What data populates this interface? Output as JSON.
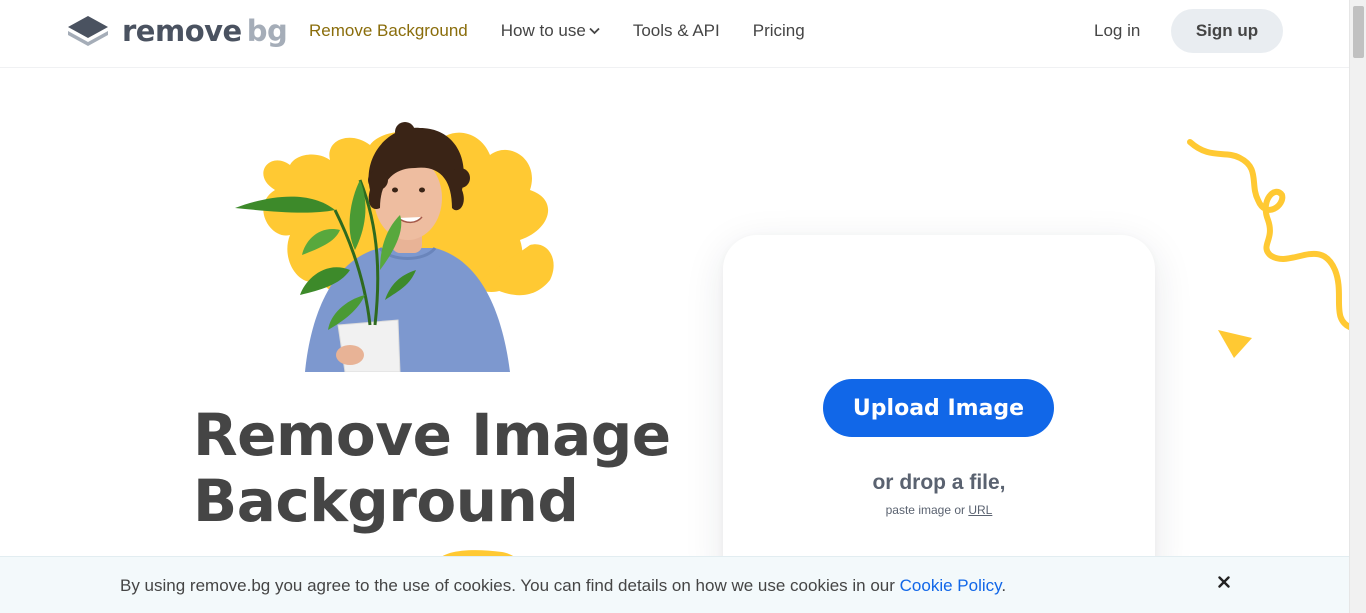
{
  "brand": {
    "word_1": "remove",
    "word_2": "bg",
    "colors": {
      "dark": "#4a5260",
      "light": "#a5adb8"
    }
  },
  "nav": {
    "items": [
      {
        "label": "Remove Background",
        "active": true
      },
      {
        "label": "How to use",
        "has_dropdown": true
      },
      {
        "label": "Tools & API"
      },
      {
        "label": "Pricing"
      }
    ],
    "login_label": "Log in",
    "signup_label": "Sign up"
  },
  "hero": {
    "title_line_1": "Remove Image",
    "title_line_2": "Background"
  },
  "upload": {
    "button_label": "Upload Image",
    "drop_text": "or drop a file,",
    "paste_prefix": "paste image or ",
    "url_label": "URL"
  },
  "cookie": {
    "text": "By using remove.bg you agree to the use of cookies. You can find details on how we use cookies in our ",
    "link_label": "Cookie Policy",
    "suffix": ".",
    "close_icon": "close-icon"
  },
  "colors": {
    "accent_blue": "#1167e8",
    "accent_yellow": "#ffc933",
    "active_nav": "#8a6d0b",
    "cookie_bg": "#f3f9fb"
  }
}
